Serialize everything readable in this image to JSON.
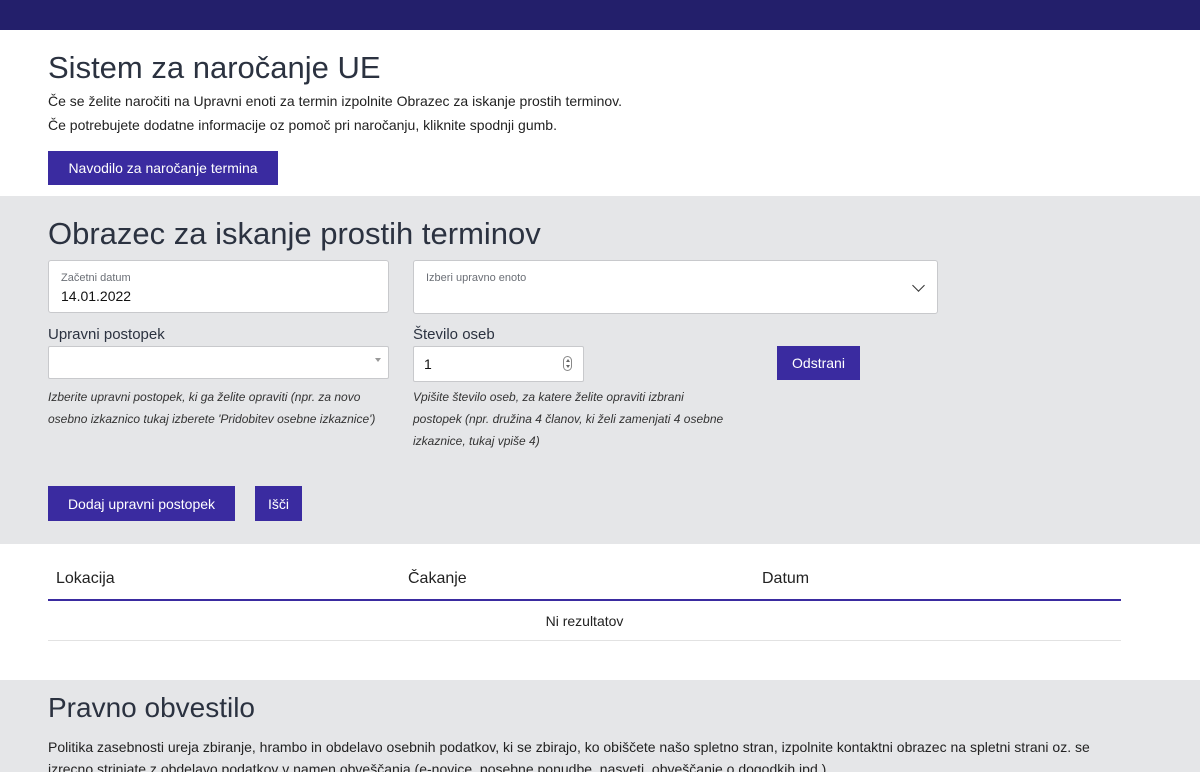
{
  "header": {
    "title": "Sistem za naročanje UE",
    "line1": "Če se želite naročiti na Upravni enoti za termin izpolnite Obrazec za iskanje prostih terminov.",
    "line2": "Če potrebujete dodatne informacije oz pomoč pri naročanju, kliknite spodnji gumb.",
    "instructions_button": "Navodilo za naročanje termina"
  },
  "form": {
    "title": "Obrazec za iskanje prostih terminov",
    "start_date": {
      "label": "Začetni datum",
      "value": "14.01.2022"
    },
    "unit_select": {
      "label": "Izberi upravno enoto",
      "value": ""
    },
    "procedure": {
      "label": "Upravni postopek",
      "value": "",
      "help": "Izberite upravni postopek, ki ga želite opraviti (npr. za novo osebno izkaznico tukaj izberete 'Pridobitev osebne izkaznice')"
    },
    "persons": {
      "label": "Število oseb",
      "value": "1",
      "help": "Vpišite število oseb, za katere želite opraviti izbrani postopek (npr. družina 4 članov, ki želi zamenjati 4 osebne izkaznice, tukaj vpiše 4)"
    },
    "remove_button": "Odstrani",
    "add_button": "Dodaj upravni postopek",
    "search_button": "Išči"
  },
  "results": {
    "columns": [
      "Lokacija",
      "Čakanje",
      "Datum"
    ],
    "empty_text": "Ni rezultatov"
  },
  "legal": {
    "title": "Pravno obvestilo",
    "text": "Politika zasebnosti ureja zbiranje, hrambo in obdelavo osebnih podatkov, ki se zbirajo, ko obiščete našo spletno stran, izpolnite kontaktni obrazec na spletni strani oz. se izrecno strinjate z obdelavo podatkov v namen obveščanja (e-novice, posebne ponudbe, nasveti, obveščanje o dogodkih ipd.)."
  },
  "colors": {
    "topbar": "#231f6b",
    "accent": "#3a2ba0",
    "section_bg": "#e5e6e8"
  }
}
